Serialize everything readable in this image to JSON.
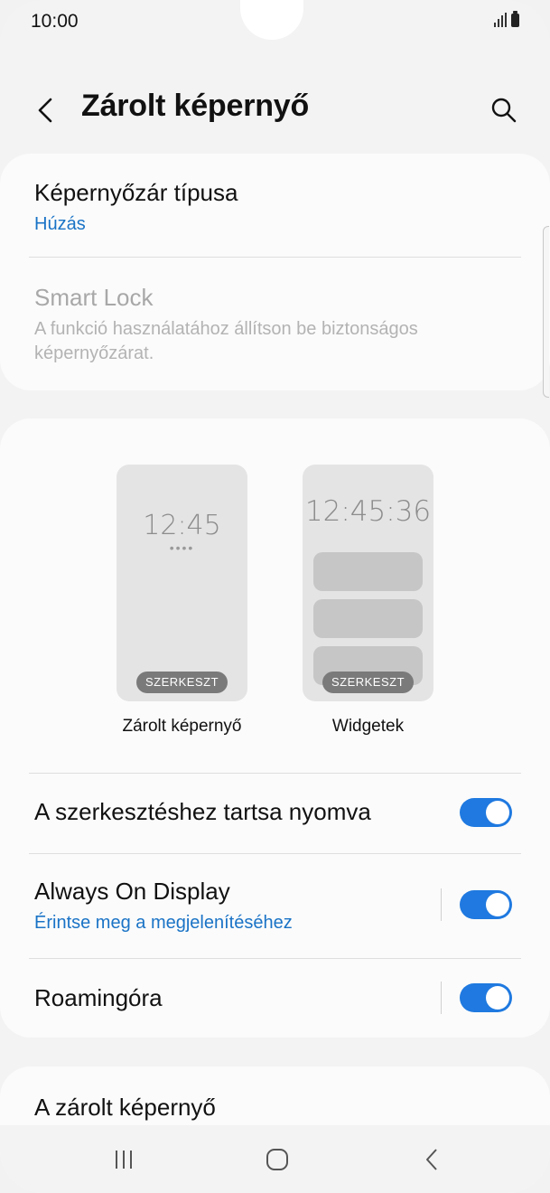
{
  "status_bar": {
    "time": "10:00"
  },
  "header": {
    "title": "Zárolt képernyő"
  },
  "icons": {
    "back": "back-chevron-icon",
    "search": "search-icon",
    "recents": "recents-icon",
    "home": "home-icon",
    "nav_back": "nav-back-icon"
  },
  "security_card": {
    "lock_type": {
      "title": "Képernyőzár típusa",
      "value": "Húzás"
    },
    "smart_lock": {
      "title": "Smart Lock",
      "description": "A funkció használatához állítson be biztonságos képernyőzárat."
    }
  },
  "previews": [
    {
      "clock": "12:45",
      "dots": "••••",
      "edit_label": "SZERKESZT",
      "label": "Zárolt képernyő"
    },
    {
      "clock": "12:45:36",
      "edit_label": "SZERKESZT",
      "label": "Widgetek"
    }
  ],
  "settings": [
    {
      "title": "A szerkesztéshez tartsa nyomva",
      "enabled": true
    },
    {
      "title": "Always On Display",
      "subtitle": "Érintse meg a megjelenítéséhez",
      "enabled": true
    },
    {
      "title": "Roamingóra",
      "enabled": true
    }
  ],
  "bottom_card": {
    "title": "A zárolt képernyő"
  },
  "colors": {
    "accent": "#1f79e0",
    "link": "#1a73c6",
    "background": "#f3f3f3",
    "card": "#fbfbfb"
  }
}
